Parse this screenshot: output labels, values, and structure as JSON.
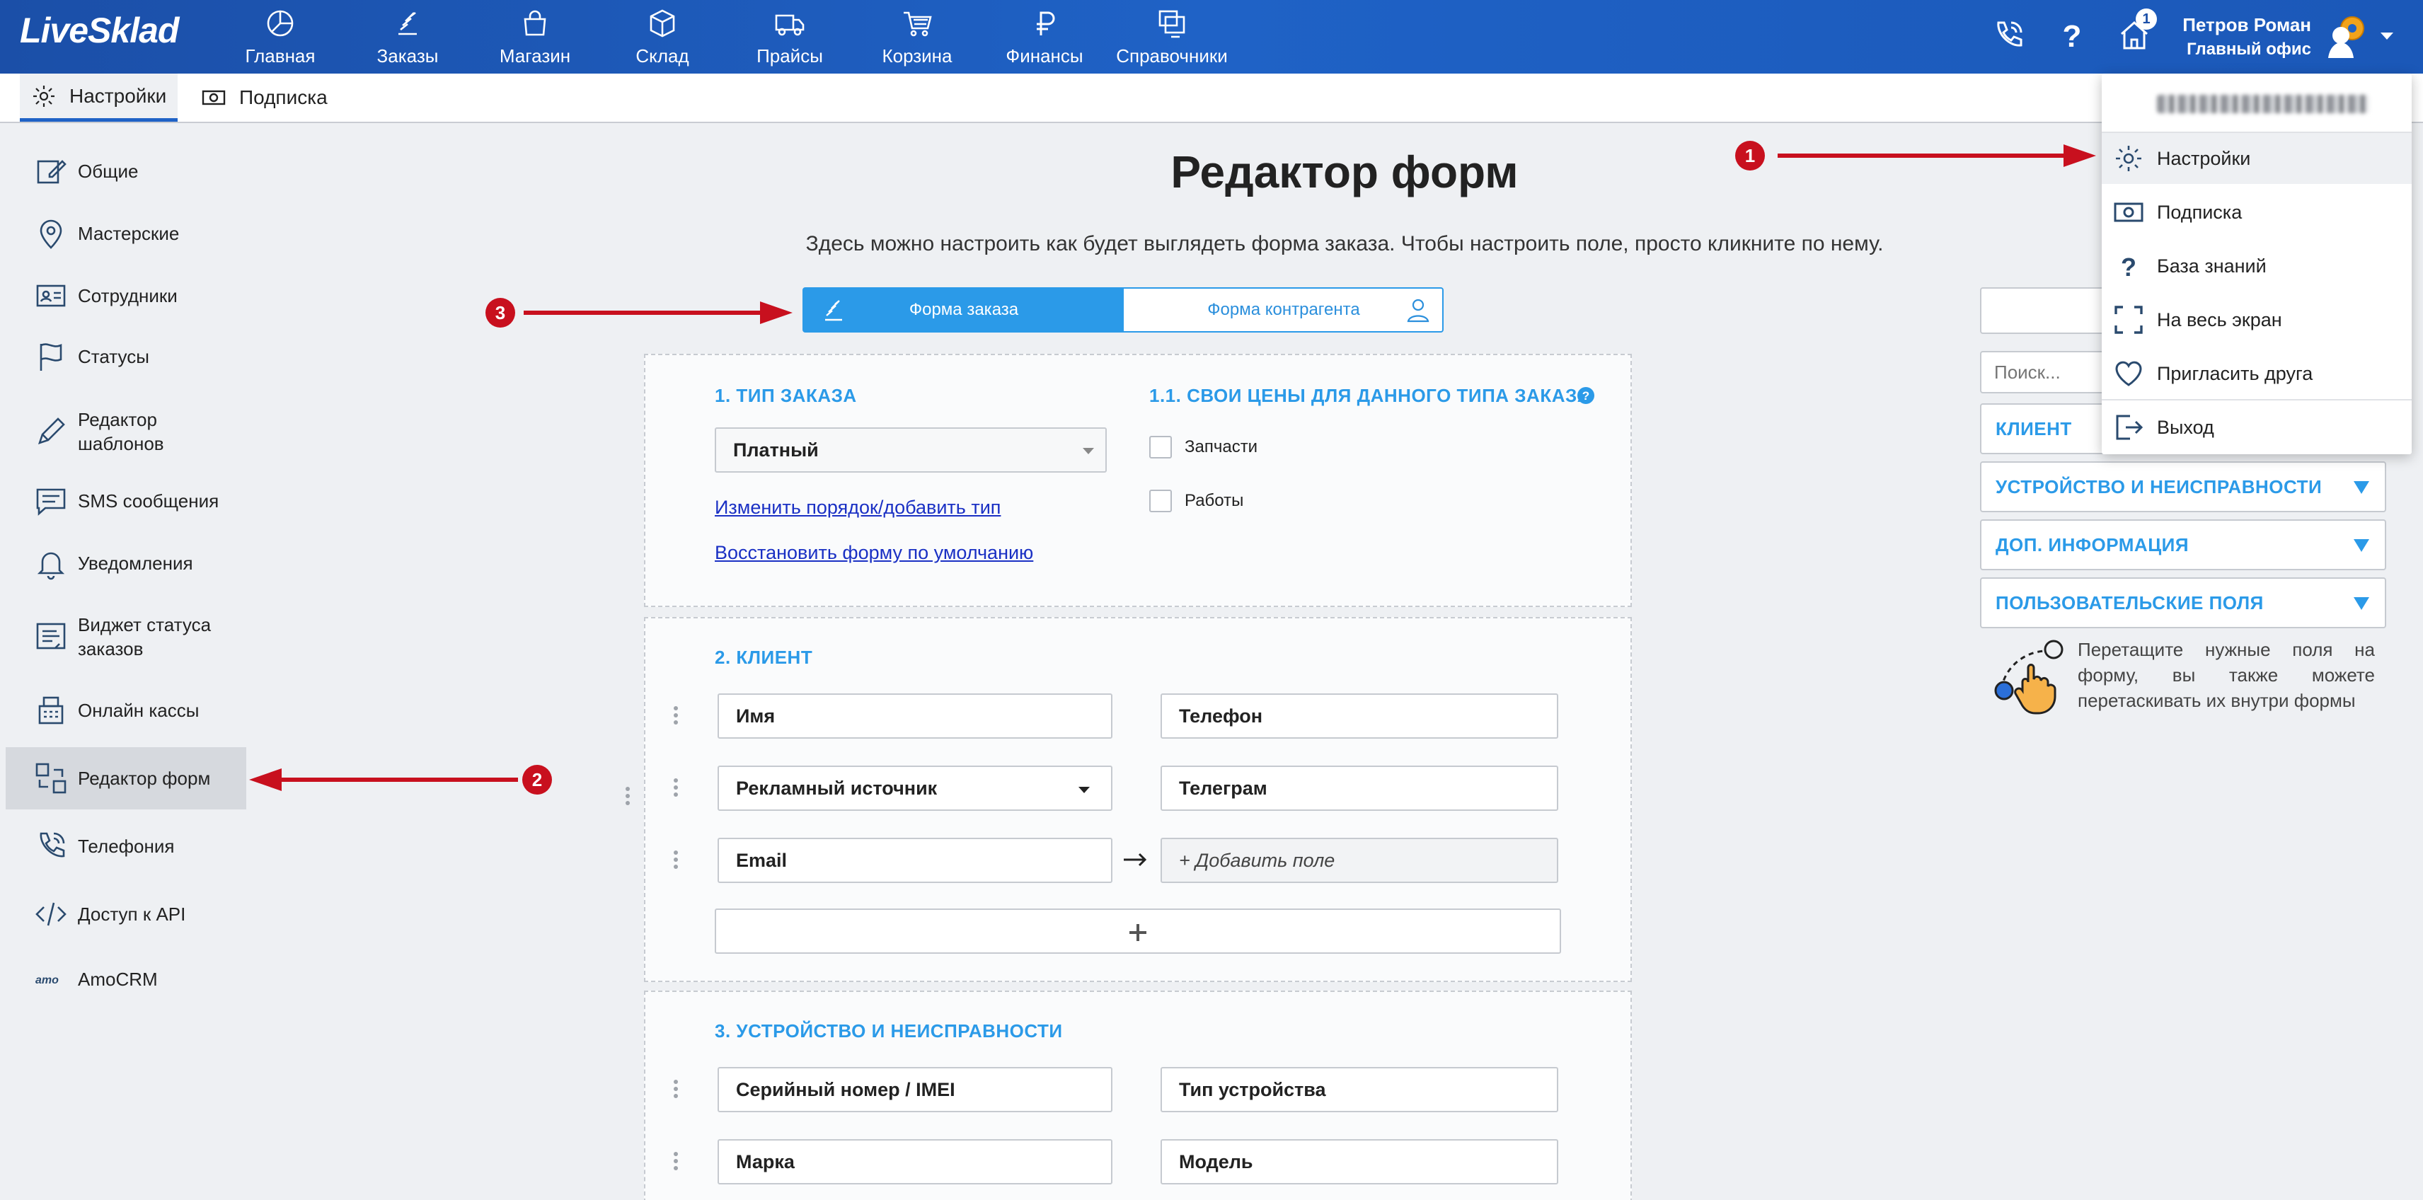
{
  "app": {
    "logo": "LiveSklad"
  },
  "topnav": {
    "items": [
      {
        "label": "Главная",
        "icon": "dashboard-icon"
      },
      {
        "label": "Заказы",
        "icon": "orders-icon"
      },
      {
        "label": "Магазин",
        "icon": "shop-bag-icon"
      },
      {
        "label": "Склад",
        "icon": "warehouse-box-icon"
      },
      {
        "label": "Прайсы",
        "icon": "truck-icon"
      },
      {
        "label": "Корзина",
        "icon": "cart-icon"
      },
      {
        "label": "Финансы",
        "icon": "ruble-icon"
      },
      {
        "label": "Справочники",
        "icon": "directories-icon"
      }
    ],
    "notifications_count": "1",
    "user_name": "Петров Роман",
    "user_office": "Главный офис"
  },
  "subbar": {
    "tabs": [
      "Настройки",
      "Подписка"
    ]
  },
  "sidebar": {
    "items": [
      {
        "label": "Общие",
        "icon": "edit-icon"
      },
      {
        "label": "Мастерские",
        "icon": "location-pin-icon"
      },
      {
        "label": "Сотрудники",
        "icon": "id-card-icon"
      },
      {
        "label": "Статусы",
        "icon": "flag-icon"
      },
      {
        "label": "Редактор шаблонов",
        "icon": "pencil-icon"
      },
      {
        "label": "SMS сообщения",
        "icon": "message-icon"
      },
      {
        "label": "Уведомления",
        "icon": "bell-icon"
      },
      {
        "label": "Виджет статуса заказов",
        "icon": "widget-icon"
      },
      {
        "label": "Онлайн кассы",
        "icon": "cash-register-icon"
      },
      {
        "label": "Редактор форм",
        "icon": "form-editor-icon"
      },
      {
        "label": "Телефония",
        "icon": "phone-icon"
      },
      {
        "label": "Доступ к API",
        "icon": "code-icon"
      },
      {
        "label": "AmoCRM",
        "icon": "amocrm-icon"
      }
    ]
  },
  "main": {
    "title": "Редактор форм",
    "description": "Здесь можно настроить как будет выглядеть форма заказа. Чтобы настроить поле, просто кликните по нему.",
    "switch": {
      "order_form": "Форма заказа",
      "contractor_form": "Форма контрагента"
    },
    "section1": {
      "title": "1. ТИП ЗАКАЗА",
      "order_type": "Платный",
      "link_change": "Изменить порядок/добавить тип",
      "link_restore": "Восстановить форму по умолчанию",
      "prices_title": "1.1. СВОИ ЦЕНЫ ДЛЯ ДАННОГО ТИПА ЗАКАЗА",
      "check_parts": "Запчасти",
      "check_works": "Работы"
    },
    "section2": {
      "title": "2. КЛИЕНТ",
      "f_name": "Имя",
      "f_phone": "Телефон",
      "f_source": "Рекламный источник",
      "f_telegram": "Телеграм",
      "f_email": "Email",
      "f_add": "+ Добавить поле"
    },
    "section3": {
      "title": "3. УСТРОЙСТВО И НЕИСПРАВНОСТИ",
      "f_serial": "Серийный номер / IMEI",
      "f_type": "Тип устройства",
      "f_brand": "Марка",
      "f_model": "Модель"
    }
  },
  "rightpanel": {
    "search_placeholder": "Поиск...",
    "groups": [
      "КЛИЕНТ",
      "УСТРОЙСТВО И НЕИСПРАВНОСТИ",
      "ДОП. ИНФОРМАЦИЯ",
      "ПОЛЬЗОВАТЕЛЬСКИЕ ПОЛЯ"
    ],
    "hint": "Перетащите нужные поля на форму, вы также можете перетаскивать их внутри формы"
  },
  "usermenu": {
    "items": [
      "Настройки",
      "Подписка",
      "База знаний",
      "На весь экран",
      "Пригласить друга",
      "Выход"
    ]
  },
  "annotations": [
    "1",
    "2",
    "3"
  ],
  "colors": {
    "nav": "#1f62c6",
    "accent": "#2b9ae8",
    "annotation": "#c8101e",
    "link": "#1a30c4"
  }
}
